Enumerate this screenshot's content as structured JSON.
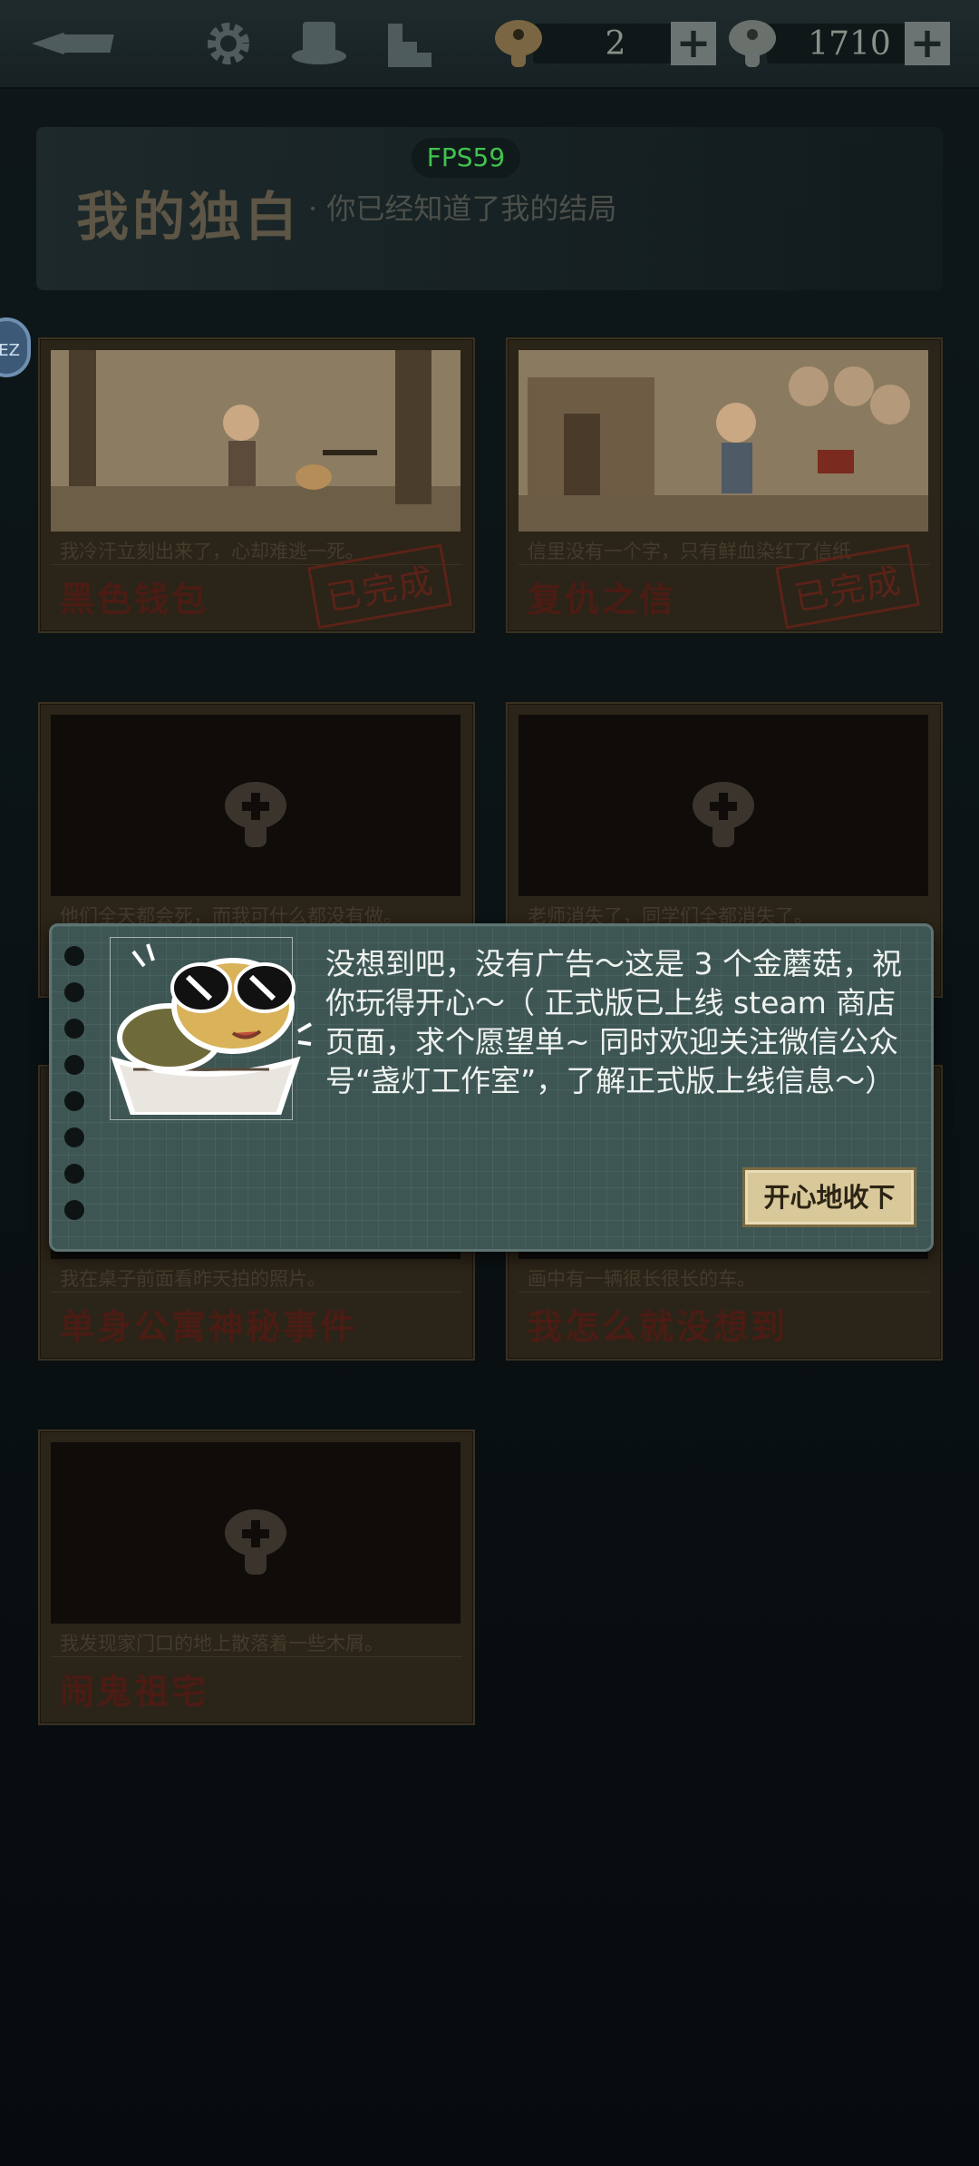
{
  "topbar": {
    "icons": [
      "quill-icon",
      "gear-icon",
      "hat-icon",
      "steps-icon"
    ],
    "resources": [
      {
        "icon": "golden-mushroom-icon",
        "value": "2",
        "plus": "+"
      },
      {
        "icon": "mushroom-icon",
        "value": "1710",
        "plus": "+"
      }
    ]
  },
  "header": {
    "title": "我的独白",
    "subtitle": "· 你已经知道了我的结局",
    "fps": "FPS59"
  },
  "side_badge": "EZ",
  "cards": [
    {
      "desc": "我冷汗立刻出来了，心却难逃一死。",
      "name": "黑色钱包",
      "stamp": "已完成"
    },
    {
      "desc": "信里没有一个字，只有鲜血染红了信纸",
      "name": "复仇之信",
      "stamp": "已完成"
    },
    {
      "desc": "他们全天都会死，而我可什么都没有做。",
      "name": ""
    },
    {
      "desc": "老师消失了，同学们全都消失了。",
      "name": ""
    },
    {
      "desc": "我在桌子前面看昨天拍的照片。",
      "name": "单身公寓神秘事件"
    },
    {
      "desc": "画中有一辆很长很长的车。",
      "name": "我怎么就没想到"
    },
    {
      "desc": "我发现家门口的地上散落着一些木屑。",
      "name": "闹鬼祖宅"
    }
  ],
  "dialog": {
    "text": "没想到吧，没有广告～这是 3 个金蘑菇，祝你玩得开心～（ 正式版已上线 steam 商店页面，求个愿望单~ 同时欢迎关注微信公众号“盏灯工作室”，了解正式版上线信息～）",
    "button": "开心地收下"
  },
  "colors": {
    "accent": "#d9c89a",
    "dialog_bg": "#3d5654",
    "card_title": "#4a1c14"
  }
}
